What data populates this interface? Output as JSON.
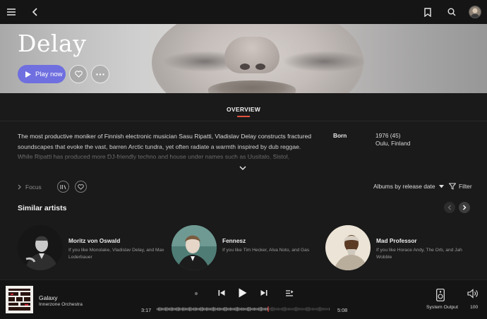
{
  "header": {
    "menu_icon": "hamburger-icon",
    "back_icon": "back-arrow-icon",
    "bookmark_icon": "bookmark-icon",
    "search_icon": "search-icon",
    "avatar_icon": "user-avatar-icon"
  },
  "artist": {
    "name": "Delay",
    "play_label": "Play now"
  },
  "tabs": [
    {
      "label": "OVERVIEW",
      "active": true
    }
  ],
  "bio": {
    "text": "The most productive moniker of Finnish electronic musician Sasu Ripatti, Vladislav Delay constructs fractured soundscapes that evoke the vast, barren Arctic tundra, yet often radiate a warmth inspired by dub reggae. While Ripatti has produced more DJ-friendly techno and house under names such as Uusitalo, Sistol,"
  },
  "facts": {
    "born_label": "Born",
    "born_line1": "1976 (45)",
    "born_line2": "Oulu, Finland"
  },
  "album_controls": {
    "focus_label": "Focus",
    "sort_label": "Albums by release date",
    "filter_label": "Filter"
  },
  "similar": {
    "title": "Similar artists",
    "artists": [
      {
        "name": "Moritz von Oswald",
        "subtitle": "If you like Monolake, Vladislav Delay, and Max Loderbauer"
      },
      {
        "name": "Fennesz",
        "subtitle": "If you like Tim Hecker, Alva Noto, and Gas"
      },
      {
        "name": "Mad Professor",
        "subtitle": "If you like Horace Andy, The Orb, and Jah Wobble"
      }
    ]
  },
  "player": {
    "track_title": "Galaxy",
    "track_artist": "Innerzone Orchestra",
    "elapsed": "3:17",
    "duration": "5:08",
    "progress_fraction": 0.64,
    "output_label": "System Output",
    "volume": "100"
  },
  "colors": {
    "accent": "#6f6fe0",
    "tab_underline": "#e0513f",
    "progress_marker": "#e04646",
    "background": "#1a1a1a"
  }
}
